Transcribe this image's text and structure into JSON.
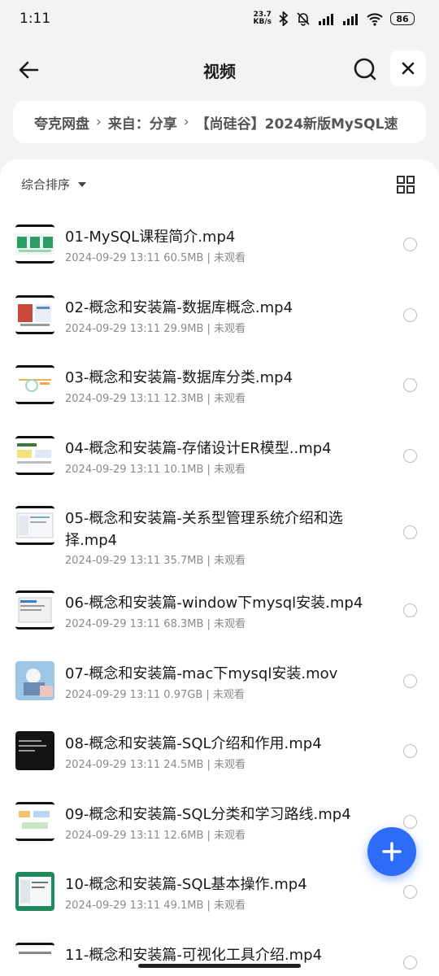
{
  "status": {
    "time": "1:11",
    "net_speed_value": "23.7",
    "net_speed_unit": "KB/s",
    "battery": "86",
    "icons": [
      "bluetooth-icon",
      "mute-bell-icon",
      "signal-hd-icon",
      "signal-hd-icon",
      "wifi-icon",
      "battery-icon"
    ]
  },
  "header": {
    "title": "视频"
  },
  "breadcrumb": {
    "root": "夸克网盘",
    "source": "来自：分享",
    "folder": "【尚硅谷】2024新版MySQL速"
  },
  "toolbar": {
    "sort_label": "综合排序"
  },
  "files": [
    {
      "name": "01-MySQL课程简介.mp4",
      "date": "2024-09-29 13:11",
      "size": "60.5MB",
      "status": "未观看"
    },
    {
      "name": "02-概念和安装篇-数据库概念.mp4",
      "date": "2024-09-29 13:11",
      "size": "29.9MB",
      "status": "未观看"
    },
    {
      "name": "03-概念和安装篇-数据库分类.mp4",
      "date": "2024-09-29 13:11",
      "size": "12.3MB",
      "status": "未观看"
    },
    {
      "name": "04-概念和安装篇-存储设计ER模型..mp4",
      "date": "2024-09-29 13:11",
      "size": "10.1MB",
      "status": "未观看"
    },
    {
      "name": "05-概念和安装篇-关系型管理系统介绍和选择.mp4",
      "date": "2024-09-29 13:11",
      "size": "35.7MB",
      "status": "未观看"
    },
    {
      "name": "06-概念和安装篇-window下mysql安装.mp4",
      "date": "2024-09-29 13:11",
      "size": "68.3MB",
      "status": "未观看"
    },
    {
      "name": "07-概念和安装篇-mac下mysql安装.mov",
      "date": "2024-09-29 13:11",
      "size": "0.97GB",
      "status": "未观看"
    },
    {
      "name": "08-概念和安装篇-SQL介绍和作用.mp4",
      "date": "2024-09-29 13:11",
      "size": "24.5MB",
      "status": "未观看"
    },
    {
      "name": "09-概念和安装篇-SQL分类和学习路线.mp4",
      "date": "2024-09-29 13:11",
      "size": "12.6MB",
      "status": "未观看"
    },
    {
      "name": "10-概念和安装篇-SQL基本操作.mp4",
      "date": "2024-09-29 13:11",
      "size": "49.1MB",
      "status": "未观看"
    },
    {
      "name": "11-概念和安装篇-可视化工具介绍.mp4",
      "date": "",
      "size": "",
      "status": ""
    }
  ],
  "colors": {
    "accent": "#2d6cf6",
    "background": "#f2f3f5",
    "panel": "#ffffff"
  }
}
